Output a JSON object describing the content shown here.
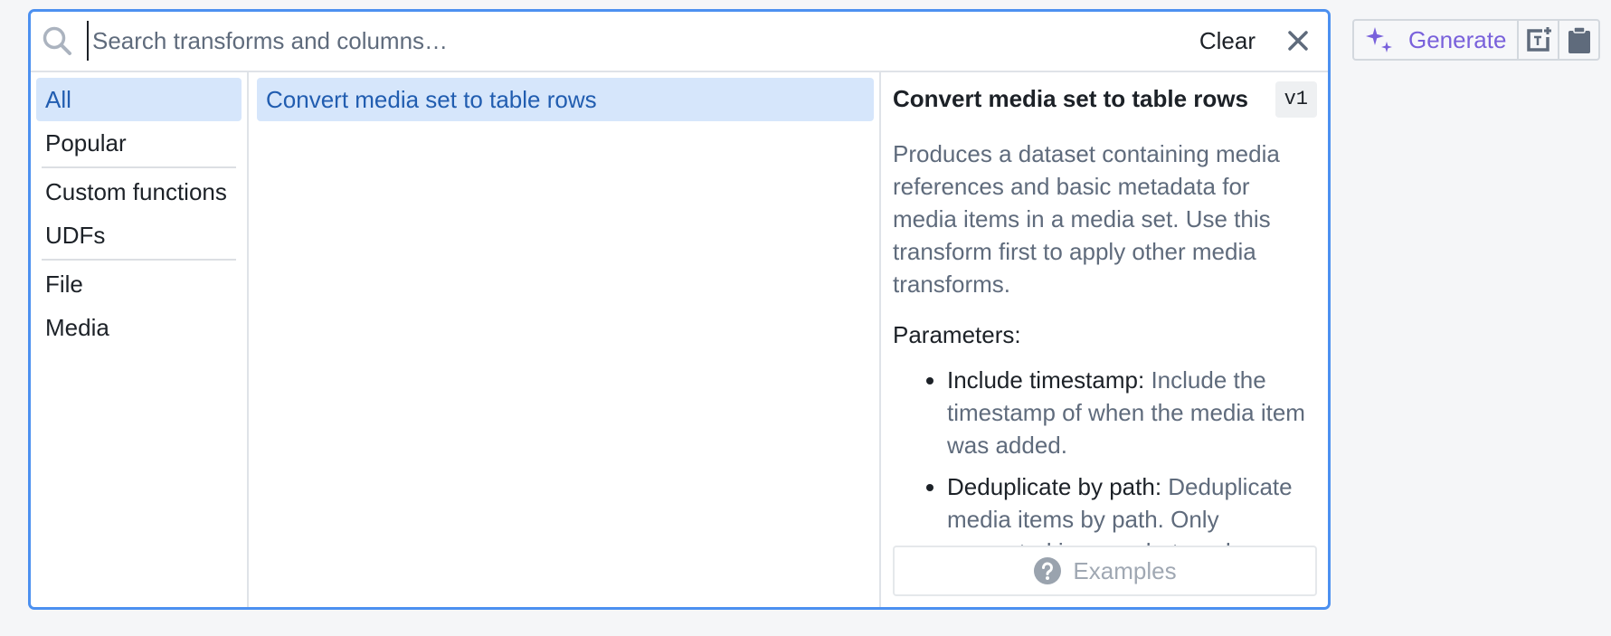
{
  "search": {
    "placeholder": "Search transforms and columns…",
    "value": "",
    "clear_label": "Clear"
  },
  "sidebar": {
    "groups": [
      [
        {
          "label": "All",
          "active": true
        },
        {
          "label": "Popular",
          "active": false
        }
      ],
      [
        {
          "label": "Custom functions",
          "active": false
        },
        {
          "label": "UDFs",
          "active": false
        }
      ],
      [
        {
          "label": "File",
          "active": false
        },
        {
          "label": "Media",
          "active": false
        }
      ]
    ]
  },
  "results": [
    {
      "label": "Convert media set to table rows",
      "selected": true
    }
  ],
  "detail": {
    "title": "Convert media set to table rows",
    "version": "v1",
    "description": "Produces a dataset containing media references and basic metadata for media items in a media set. Use this transform first to apply other media transforms.",
    "parameters_label": "Parameters:",
    "parameters": [
      {
        "name": "Include timestamp:",
        "description": "Include the timestamp of when the media item was added."
      },
      {
        "name": "Deduplicate by path:",
        "description": "Deduplicate media items by path. Only supported in snapshot mode."
      }
    ],
    "examples_label": "Examples"
  },
  "toolbar": {
    "generate_label": "Generate",
    "icons": [
      "sparkle-icon",
      "add-text-box-icon",
      "clipboard-icon"
    ]
  },
  "colors": {
    "accent_border": "#4c90f0",
    "selected_bg": "#d6e6fb",
    "selected_text": "#215db0",
    "generate_purple": "#7961db"
  }
}
